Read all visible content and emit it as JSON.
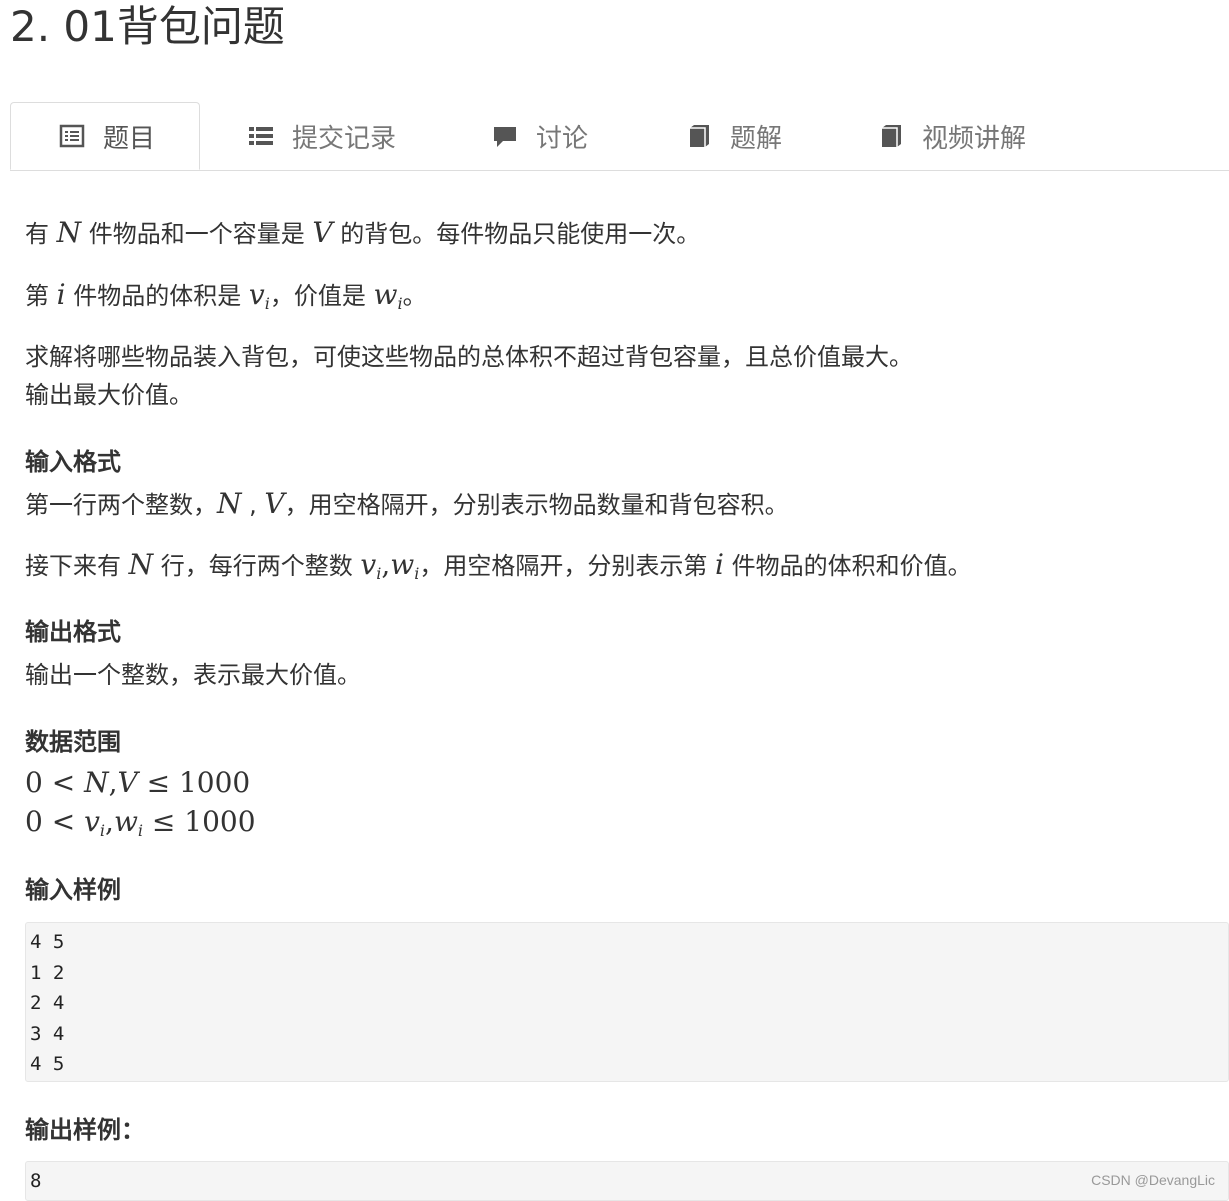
{
  "title": "2. 01背包问题",
  "tabs": [
    {
      "label": "题目",
      "icon": "list-alt-icon"
    },
    {
      "label": "提交记录",
      "icon": "list-icon"
    },
    {
      "label": "讨论",
      "icon": "comment-icon"
    },
    {
      "label": "题解",
      "icon": "book-icon"
    },
    {
      "label": "视频讲解",
      "icon": "book-icon"
    }
  ],
  "description": {
    "p1": {
      "a": "有 ",
      "N": "N",
      "b": " 件物品和一个容量是 ",
      "V": "V",
      "c": " 的背包。每件物品只能使用一次。"
    },
    "p2": {
      "a": "第 ",
      "i": "i",
      "b": " 件物品的体积是 ",
      "v": "v",
      "vi": "i",
      "c": "，价值是 ",
      "w": "w",
      "wi": "i",
      "d": "。"
    },
    "p3": "求解将哪些物品装入背包，可使这些物品的总体积不超过背包容量，且总价值最大。",
    "p4": "输出最大价值。"
  },
  "input_format": {
    "heading": "输入格式",
    "line1": {
      "a": "第一行两个整数，",
      "N": "N",
      "sep": " , ",
      "V": "V",
      "b": "，用空格隔开，分别表示物品数量和背包容积。"
    },
    "line2": {
      "a": "接下来有 ",
      "N": "N",
      "b": " 行，每行两个整数 ",
      "v": "v",
      "vi": "i",
      "comma": ",",
      "w": "w",
      "wi": "i",
      "c": "，用空格隔开，分别表示第 ",
      "i": "i",
      "d": " 件物品的体积和价值。"
    }
  },
  "output_format": {
    "heading": "输出格式",
    "line": "输出一个整数，表示最大价值。"
  },
  "data_range": {
    "heading": "数据范围",
    "r1": {
      "a": "0 < ",
      "N": "N",
      "comma": ",",
      "V": "V",
      "b": " ≤ 1000"
    },
    "r2": {
      "a": "0 < ",
      "v": "v",
      "vi": "i",
      "comma": ",",
      "w": "w",
      "wi": "i",
      "b": " ≤ 1000"
    }
  },
  "sample_input": {
    "heading": "输入样例",
    "lines": [
      "4 5",
      "1 2",
      "2 4",
      "3 4",
      "4 5"
    ]
  },
  "sample_output": {
    "heading": "输出样例：",
    "lines": [
      "8"
    ]
  },
  "watermark": "CSDN @DevangLic"
}
